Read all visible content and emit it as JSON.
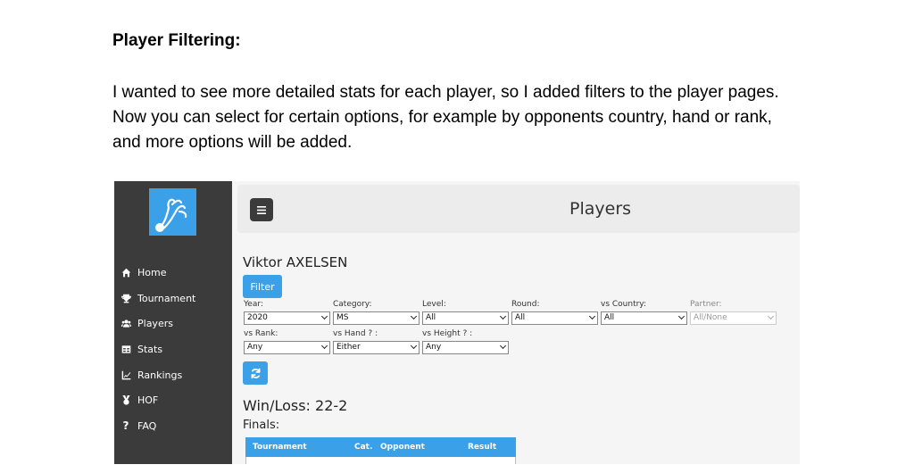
{
  "document": {
    "heading": "Player Filtering:",
    "paragraph": "I wanted to see more detailed stats for each player, so I added filters to the player pages. Now you can select for certain options, for example by opponents country, hand or rank, and more options will be added."
  },
  "sidebar": {
    "items": [
      {
        "label": "Home",
        "icon": "home-icon"
      },
      {
        "label": "Tournament",
        "icon": "trophy-icon"
      },
      {
        "label": "Players",
        "icon": "users-icon"
      },
      {
        "label": "Stats",
        "icon": "table-icon"
      },
      {
        "label": "Rankings",
        "icon": "chart-line-icon"
      },
      {
        "label": "HOF",
        "icon": "medal-icon"
      },
      {
        "label": "FAQ",
        "icon": "question-icon"
      }
    ]
  },
  "header": {
    "title": "Players"
  },
  "player": {
    "name": "Viktor AXELSEN"
  },
  "filter_button": "Filter",
  "filters": [
    {
      "label": "Year:",
      "value": "2020"
    },
    {
      "label": "Category:",
      "value": "MS"
    },
    {
      "label": "Level:",
      "value": "All"
    },
    {
      "label": "Round:",
      "value": "All"
    },
    {
      "label": "vs Country:",
      "value": "All"
    },
    {
      "label": "Partner:",
      "value": "All/None",
      "disabled": true
    },
    {
      "label": "vs Rank:",
      "value": "Any"
    },
    {
      "label": "vs Hand ? :",
      "value": "Either"
    },
    {
      "label": "vs Height ? :",
      "value": "Any"
    }
  ],
  "summary": {
    "winloss": "Win/Loss: 22-2",
    "finals": "Finals:"
  },
  "table": {
    "headers": [
      "Tournament",
      "Cat.",
      "Opponent",
      "Result"
    ]
  },
  "colors": {
    "accent": "#3aa0e8",
    "sidebar": "#3b3b3b"
  }
}
